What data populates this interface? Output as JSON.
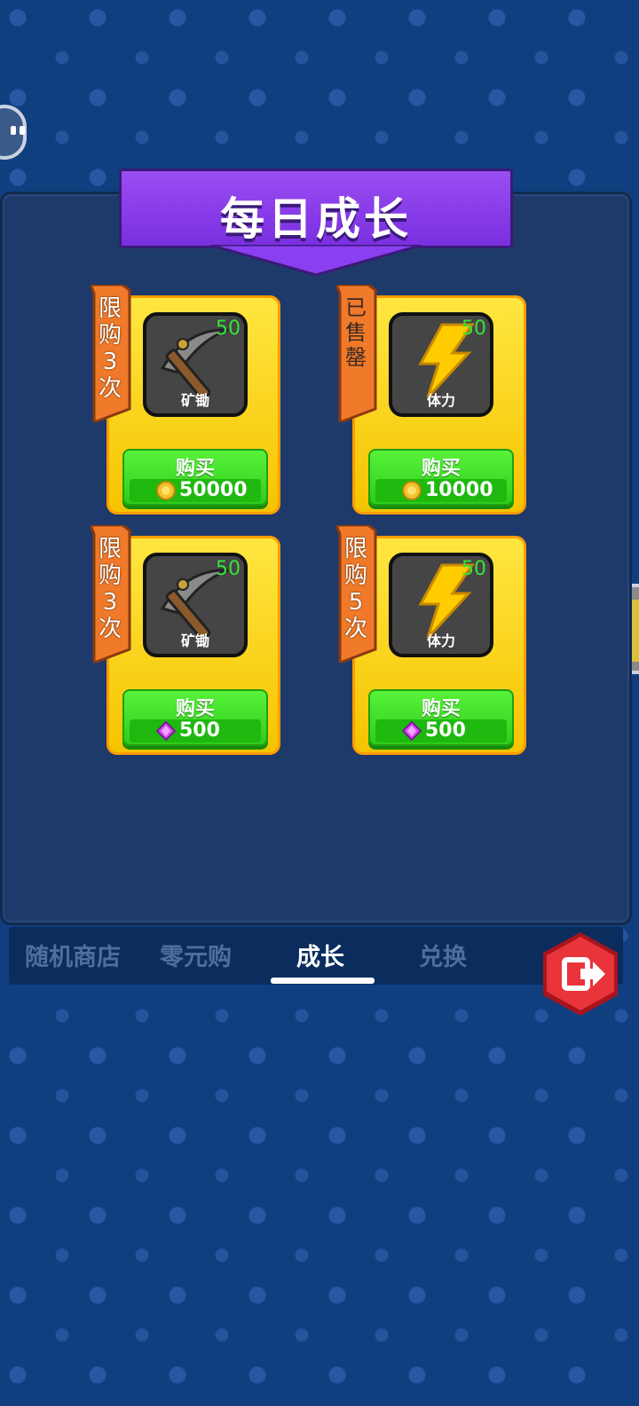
{
  "page": {
    "title": "每日成长"
  },
  "cards": [
    {
      "tag": "限购3次",
      "tag_chars": [
        "限",
        "购",
        "3",
        "次"
      ],
      "tag_sold": false,
      "item_name": "矿锄",
      "item_icon": "pickaxe-icon",
      "qty": "50",
      "buy_label": "购买",
      "currency_icon": "gold-coin-icon",
      "price": "50000"
    },
    {
      "tag": "已售罄",
      "tag_chars": [
        "已",
        "售",
        "罄"
      ],
      "tag_sold": true,
      "item_name": "体力",
      "item_icon": "lightning-icon",
      "qty": "50",
      "buy_label": "购买",
      "currency_icon": "gold-coin-icon",
      "price": "10000"
    },
    {
      "tag": "限购3次",
      "tag_chars": [
        "限",
        "购",
        "3",
        "次"
      ],
      "tag_sold": false,
      "item_name": "矿锄",
      "item_icon": "pickaxe-icon",
      "qty": "50",
      "buy_label": "购买",
      "currency_icon": "purple-gem-icon",
      "price": "500"
    },
    {
      "tag": "限购5次",
      "tag_chars": [
        "限",
        "购",
        "5",
        "次"
      ],
      "tag_sold": false,
      "item_name": "体力",
      "item_icon": "lightning-icon",
      "qty": "50",
      "buy_label": "购买",
      "currency_icon": "purple-gem-icon",
      "price": "500"
    }
  ],
  "tabs": [
    {
      "label": "随机商店",
      "active": false
    },
    {
      "label": "零元购",
      "active": false
    },
    {
      "label": "成长",
      "active": true
    },
    {
      "label": "兑换",
      "active": false
    }
  ],
  "exit_button": {
    "icon": "exit-icon"
  },
  "colors": {
    "background": "#0f3f7f",
    "panel": "#1d3a6b",
    "banner": "#8a3ff0",
    "card": "#ffd700",
    "buy_button": "#3fdc22",
    "tag": "#f07a2a",
    "active_tab": "#ffffff",
    "inactive_tab": "#4d6f9e"
  }
}
